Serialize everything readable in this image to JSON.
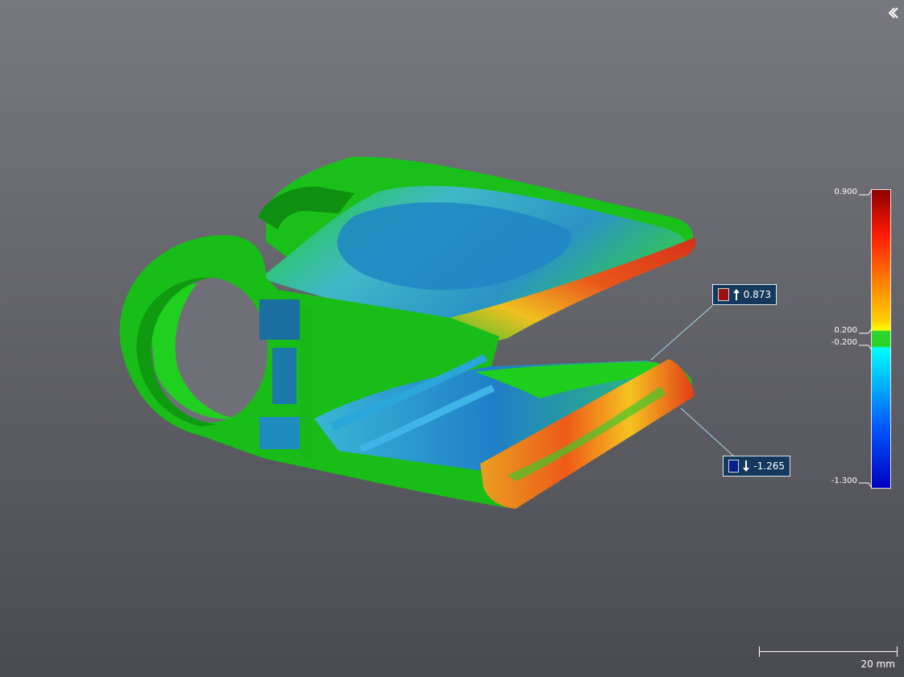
{
  "viewer": {
    "collapse_icon": "chevron-left-icon",
    "scale_bar": {
      "label": "20 mm"
    }
  },
  "colors": {
    "background_top": "#787880",
    "background_bottom": "#4a4a52",
    "callout_bg": "#14395c",
    "max_swatch": "#9b1010",
    "min_swatch": "#0a1d8c",
    "tolerance_green": "#12d112"
  },
  "annotations": {
    "max": {
      "icon": "arrow-up-icon",
      "value": "0.873",
      "color": "#9b1010"
    },
    "min": {
      "icon": "arrow-down-icon",
      "value": "-1.265",
      "color": "#0a1d8c"
    }
  },
  "legend": {
    "labels": {
      "top": "0.900",
      "upper_tolerance": "0.200",
      "lower_tolerance": "-0.200",
      "bottom": "-1.300"
    },
    "range": [
      -1.3,
      0.9
    ],
    "tolerance": [
      -0.2,
      0.2
    ]
  }
}
